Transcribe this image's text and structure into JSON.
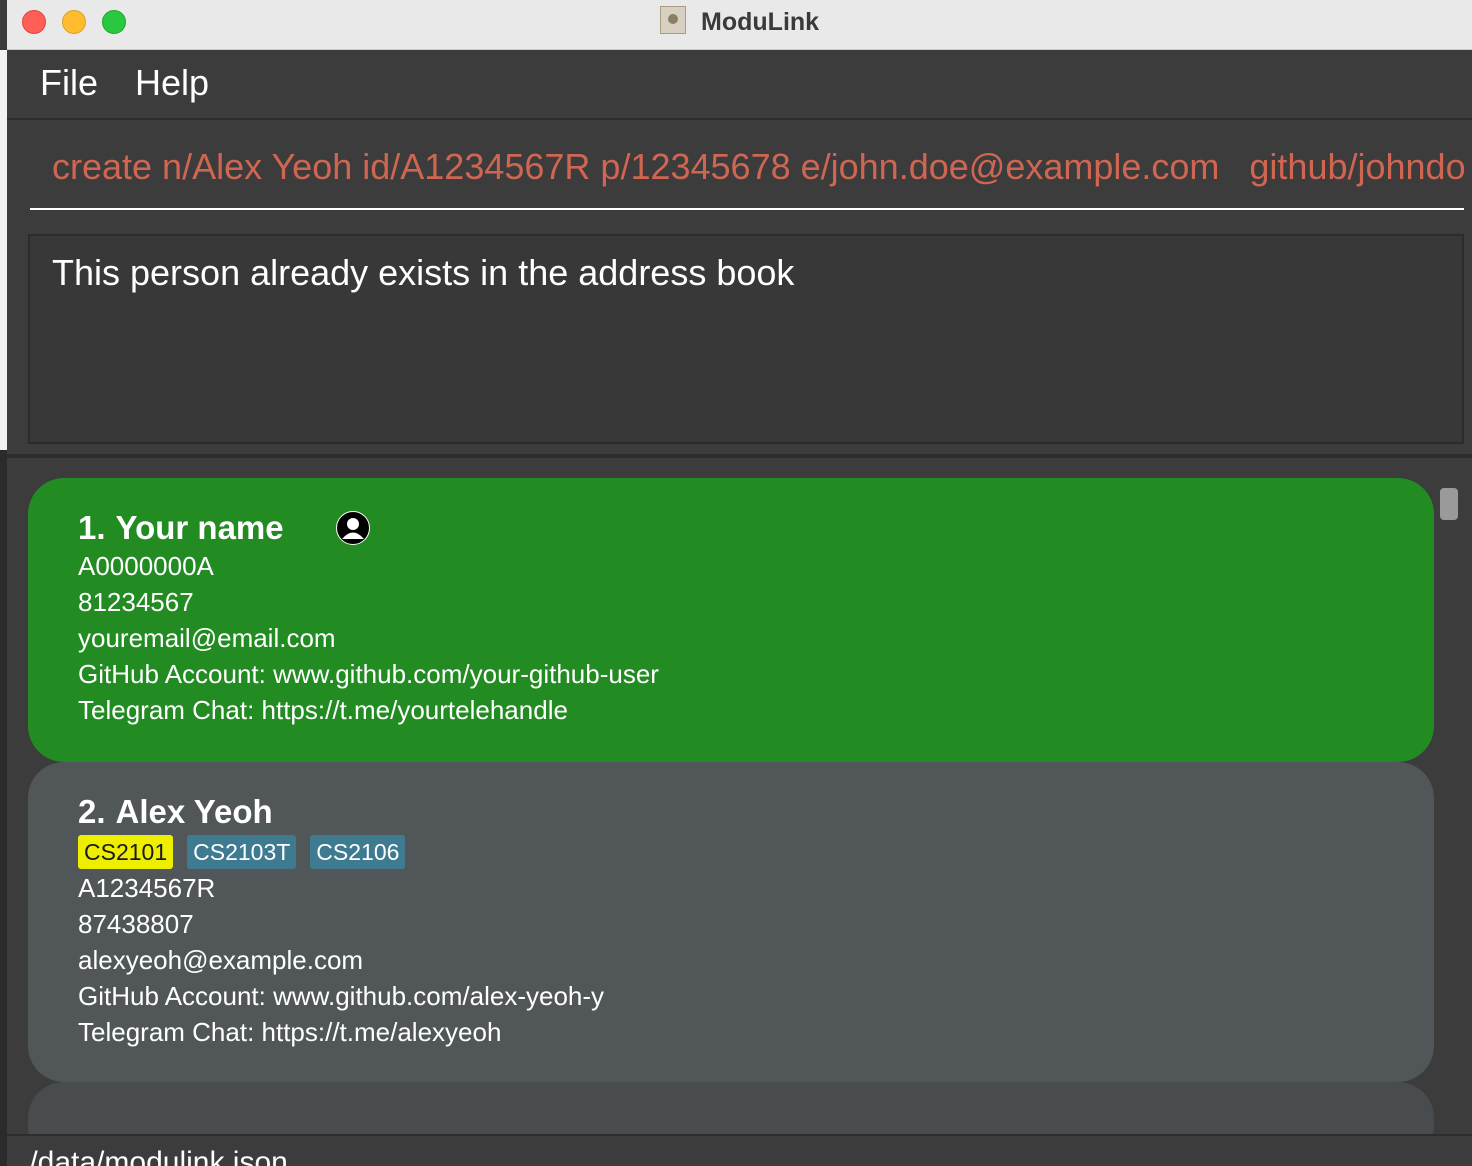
{
  "window": {
    "title": "ModuLink"
  },
  "menu": {
    "items": [
      "File",
      "Help"
    ]
  },
  "command_box": {
    "value": "create n/Alex Yeoh id/A1234567R p/12345678 e/john.doe@example.com   github/johndo"
  },
  "result_display": {
    "text": "This person already exists in the address book"
  },
  "person_list": {
    "cards": [
      {
        "index": "1.",
        "name": "Your name",
        "is_self": true,
        "tags": [],
        "student_id": "A0000000A",
        "phone": "81234567",
        "email": "youremail@email.com",
        "github": "GitHub Account: www.github.com/your-github-user",
        "telegram": "Telegram Chat: https://t.me/yourtelehandle",
        "color": "#228b22"
      },
      {
        "index": "2.",
        "name": "Alex Yeoh",
        "is_self": false,
        "tags": [
          "CS2101",
          "CS2103T",
          "CS2106"
        ],
        "tag_colors": [
          "#eeee00",
          "#3e7b91",
          "#3e7b91"
        ],
        "student_id": "A1234567R",
        "phone": "87438807",
        "email": "alexyeoh@example.com",
        "github": "GitHub Account: www.github.com/alex-yeoh-y",
        "telegram": "Telegram Chat: https://t.me/alexyeoh",
        "color": "#515658"
      }
    ]
  },
  "status_bar": {
    "save_location": "./data/modulink.json"
  },
  "colors": {
    "background": "#3c3c3c",
    "command_text": "#d06651",
    "self_card": "#228b22",
    "card": "#515658"
  }
}
